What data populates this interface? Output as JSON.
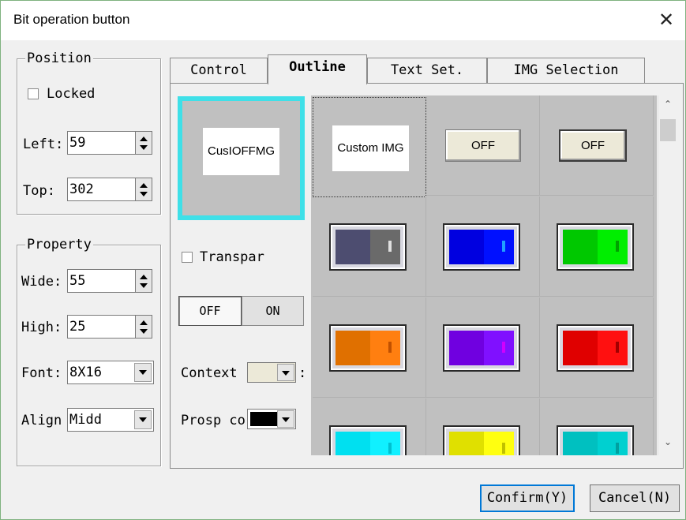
{
  "window": {
    "title": "Bit operation button"
  },
  "position": {
    "legend": "Position",
    "locked_label": "Locked",
    "left_label": "Left:",
    "left_value": "59",
    "top_label": "Top:",
    "top_value": "302"
  },
  "property": {
    "legend": "Property",
    "wide_label": "Wide:",
    "wide_value": "55",
    "high_label": "High:",
    "high_value": "25",
    "font_label": "Font:",
    "font_value": "8X16",
    "align_label": "Align",
    "align_value": "Midd"
  },
  "tabs": [
    {
      "label": "Control"
    },
    {
      "label": "Outline"
    },
    {
      "label": "Text Set."
    },
    {
      "label": "IMG Selection"
    }
  ],
  "active_tab": "Outline",
  "outline": {
    "preview_text": "CusIOFFMG",
    "transparent_label": "Transpar",
    "state_off": "OFF",
    "state_on": "ON",
    "context_label": "Context",
    "context_suffix": ":",
    "prosp_label": "Prosp co",
    "context_color": "#ece9d8",
    "prosp_color": "#000000"
  },
  "gallery": {
    "row1": [
      {
        "type": "custom",
        "text": "Custom IMG"
      },
      {
        "type": "off",
        "text": "OFF"
      },
      {
        "type": "off-framed",
        "text": "OFF"
      }
    ],
    "toggle_colors": [
      {
        "left": "#4d4d70",
        "right": "#6a6a6a",
        "mark": "#e0e0e0"
      },
      {
        "left": "#0000e0",
        "right": "#0010ff",
        "mark": "#20a0ff"
      },
      {
        "left": "#00c800",
        "right": "#00ee00",
        "mark": "#00a000"
      },
      {
        "left": "#e07000",
        "right": "#ff7f10",
        "mark": "#c05000"
      },
      {
        "left": "#7000e0",
        "right": "#8010ff",
        "mark": "#d000ff"
      },
      {
        "left": "#e00000",
        "right": "#ff1010",
        "mark": "#a00000"
      },
      {
        "left": "#00e0f0",
        "right": "#10f0ff",
        "mark": "#00c0d0"
      },
      {
        "left": "#e0e000",
        "right": "#ffff10",
        "mark": "#c0c000"
      },
      {
        "left": "#00c0c0",
        "right": "#00d0d0",
        "mark": "#00a0a0"
      }
    ]
  },
  "footer": {
    "confirm": "Confirm(Y)",
    "cancel": "Cancel(N)"
  }
}
